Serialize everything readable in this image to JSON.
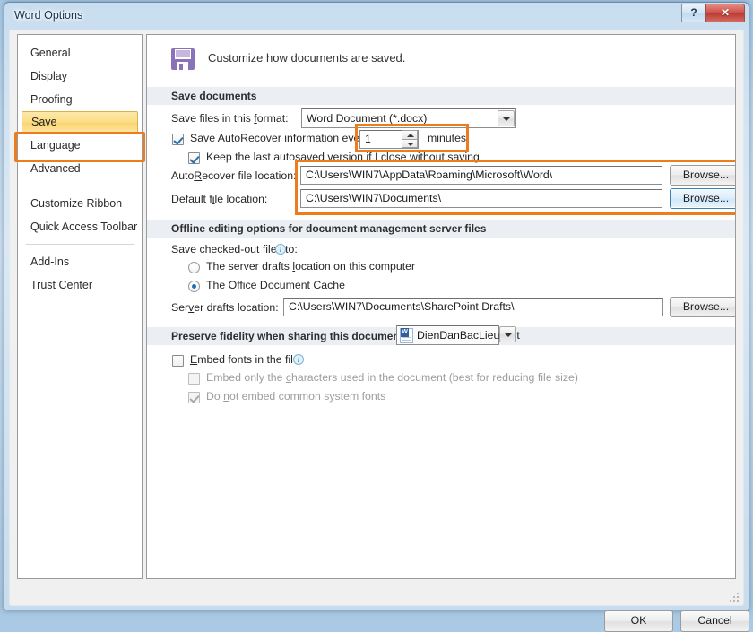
{
  "window": {
    "title": "Word Options",
    "help_button": "?",
    "close_button": "✕"
  },
  "sidebar": {
    "items": [
      {
        "label": "General",
        "selected": false
      },
      {
        "label": "Display",
        "selected": false
      },
      {
        "label": "Proofing",
        "selected": false
      },
      {
        "label": "Save",
        "selected": true
      },
      {
        "label": "Language",
        "selected": false
      },
      {
        "label": "Advanced",
        "selected": false
      },
      {
        "label": "Customize Ribbon",
        "selected": false
      },
      {
        "label": "Quick Access Toolbar",
        "selected": false
      },
      {
        "label": "Add-Ins",
        "selected": false
      },
      {
        "label": "Trust Center",
        "selected": false
      }
    ]
  },
  "panel": {
    "header_text": "Customize how documents are saved.",
    "header_icon": "floppy-disk-icon",
    "sections": {
      "save_documents": {
        "title": "Save documents",
        "format_label": "Save files in this format:",
        "format_value": "Word Document (*.docx)",
        "autorecover_label": "Save AutoRecover information every",
        "autorecover_checked": true,
        "autorecover_minutes": "1",
        "minutes_label": "minutes",
        "keep_last_label": "Keep the last autosaved version if I close without saving",
        "keep_last_checked": true,
        "autorecover_location_label": "AutoRecover file location:",
        "autorecover_location_value": "C:\\Users\\WIN7\\AppData\\Roaming\\Microsoft\\Word\\",
        "default_location_label": "Default file location:",
        "default_location_value": "C:\\Users\\WIN7\\Documents\\",
        "browse_label": "Browse..."
      },
      "offline_editing": {
        "title": "Offline editing options for document management server files",
        "checked_out_label": "Save checked-out files to:",
        "info_icon": "info-icon",
        "radio_server_drafts": "The server drafts location on this computer",
        "radio_office_cache": "The Office Document Cache",
        "selected_radio": "office_cache",
        "server_drafts_label": "Server drafts location:",
        "server_drafts_value": "C:\\Users\\WIN7\\Documents\\SharePoint Drafts\\",
        "browse_label": "Browse..."
      },
      "preserve_fidelity": {
        "title": "Preserve fidelity when sharing this document:",
        "document_value": "DienDanBacLieu.Net",
        "document_icon": "word-document-icon",
        "embed_fonts_label": "Embed fonts in the file",
        "embed_fonts_checked": false,
        "embed_chars_label": "Embed only the characters used in the document (best for reducing file size)",
        "embed_chars_checked": false,
        "embed_chars_disabled": true,
        "no_common_fonts_label": "Do not embed common system fonts",
        "no_common_fonts_checked": true,
        "no_common_fonts_disabled": true
      }
    }
  },
  "footer": {
    "ok_label": "OK",
    "cancel_label": "Cancel"
  },
  "annotations": {
    "accent_color": "#ec7c1c",
    "highlight_color": "#fcdd84"
  }
}
